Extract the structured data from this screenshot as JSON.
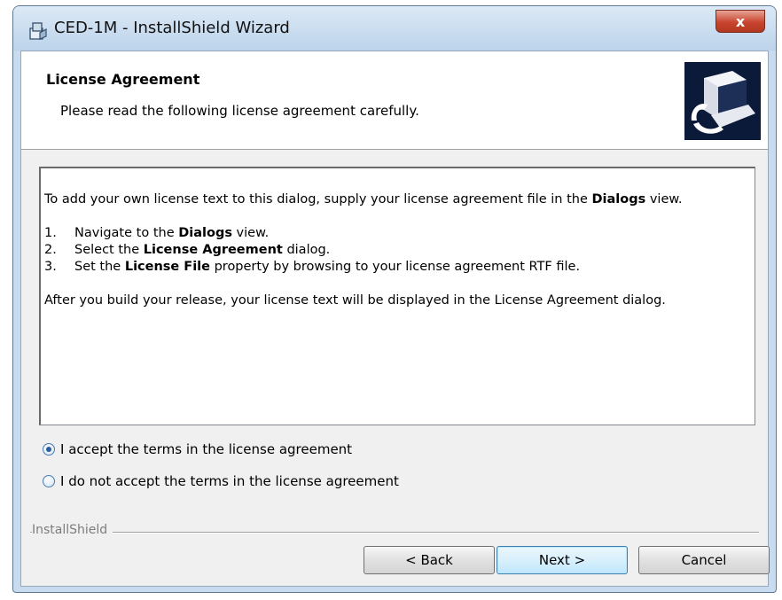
{
  "window": {
    "title": "CED-1M - InstallShield Wizard",
    "close_label": "x"
  },
  "banner": {
    "title": "License Agreement",
    "subtitle": "Please read the following license agreement carefully."
  },
  "license": {
    "para1_prefix": "To add your own license text to this dialog, supply your license agreement file in the ",
    "para1_bold": "Dialogs",
    "para1_suffix": " view.",
    "steps": [
      {
        "num": "1.",
        "pre": "Navigate to the ",
        "bold": "Dialogs",
        "post": " view."
      },
      {
        "num": "2.",
        "pre": "Select the ",
        "bold": "License Agreement",
        "post": " dialog."
      },
      {
        "num": "3.",
        "pre": "Set the ",
        "bold": "License File",
        "post": " property by browsing to your license agreement RTF file."
      }
    ],
    "para2": "After you build your release, your license text will be displayed in the License Agreement dialog."
  },
  "options": {
    "accept_label": "I accept the terms in the license agreement",
    "decline_label": "I do not accept the terms in the license agreement",
    "selected": "accept"
  },
  "footer": {
    "brand": "InstallShield",
    "back_label": "< Back",
    "next_label": "Next >",
    "cancel_label": "Cancel"
  },
  "colors": {
    "banner_logo_bg": "#0c1a3a",
    "default_button_border": "#3c7fb1"
  }
}
